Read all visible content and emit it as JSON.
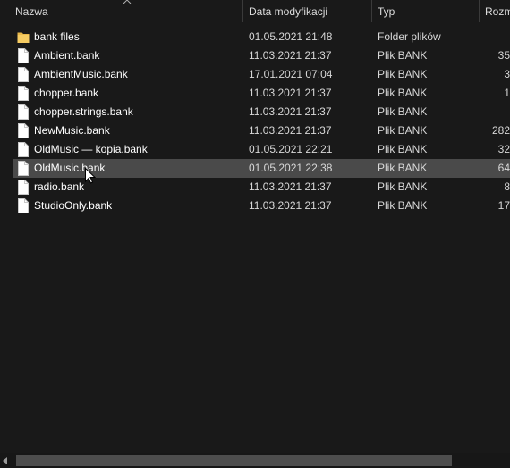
{
  "columns": {
    "name": "Nazwa",
    "date": "Data modyfikacji",
    "type": "Typ",
    "size": "Rozm"
  },
  "files": [
    {
      "name": "bank files",
      "date": "01.05.2021 21:48",
      "type": "Folder plików",
      "size": "",
      "icon": "folder-icon"
    },
    {
      "name": "Ambient.bank",
      "date": "11.03.2021 21:37",
      "type": "Plik BANK",
      "size": "35",
      "icon": "file-icon"
    },
    {
      "name": "AmbientMusic.bank",
      "date": "17.01.2021 07:04",
      "type": "Plik BANK",
      "size": "3",
      "icon": "file-icon"
    },
    {
      "name": "chopper.bank",
      "date": "11.03.2021 21:37",
      "type": "Plik BANK",
      "size": "1",
      "icon": "file-icon"
    },
    {
      "name": "chopper.strings.bank",
      "date": "11.03.2021 21:37",
      "type": "Plik BANK",
      "size": "",
      "icon": "file-icon"
    },
    {
      "name": "NewMusic.bank",
      "date": "11.03.2021 21:37",
      "type": "Plik BANK",
      "size": "282",
      "icon": "file-icon"
    },
    {
      "name": "OldMusic — kopia.bank",
      "date": "01.05.2021 22:21",
      "type": "Plik BANK",
      "size": "32",
      "icon": "file-icon"
    },
    {
      "name": "OldMusic.bank",
      "date": "01.05.2021 22:38",
      "type": "Plik BANK",
      "size": "64",
      "icon": "file-icon",
      "selected": true
    },
    {
      "name": "radio.bank",
      "date": "11.03.2021 21:37",
      "type": "Plik BANK",
      "size": "8",
      "icon": "file-icon"
    },
    {
      "name": "StudioOnly.bank",
      "date": "11.03.2021 21:37",
      "type": "Plik BANK",
      "size": "17",
      "icon": "file-icon"
    }
  ],
  "colors": {
    "background": "#191919",
    "selected_row": "#4a4a4a",
    "folder": "#f2c55c",
    "file": "#ffffff"
  }
}
